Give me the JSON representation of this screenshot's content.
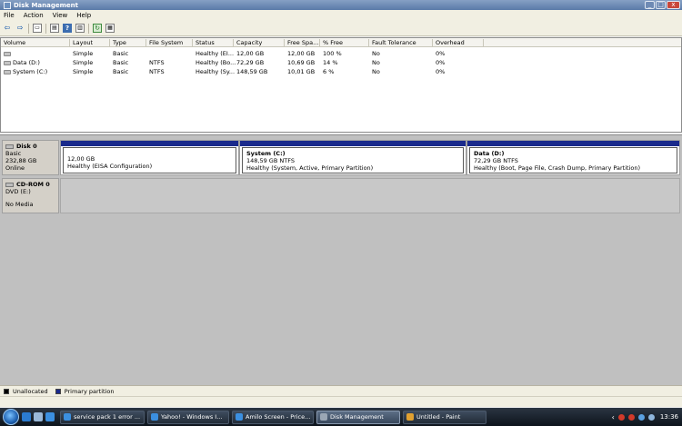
{
  "window": {
    "title": "Disk Management"
  },
  "window_controls": {
    "minimize": "_",
    "maximize": "□",
    "close": "x"
  },
  "menu": [
    "File",
    "Action",
    "View",
    "Help"
  ],
  "toolbar": {
    "back_glyph": "⇦",
    "forward_glyph": "⇨",
    "icons": [
      "back-arrow-icon",
      "forward-arrow-icon",
      "disk-list-icon",
      "properties-icon",
      "help-icon",
      "refresh-icon",
      "rescan-icon"
    ]
  },
  "volume_list": {
    "columns": [
      "Volume",
      "Layout",
      "Type",
      "File System",
      "Status",
      "Capacity",
      "Free Spa...",
      "% Free",
      "Fault Tolerance",
      "Overhead"
    ],
    "rows": [
      [
        "",
        "Simple",
        "Basic",
        "",
        "Healthy (EI...",
        "12,00 GB",
        "12,00 GB",
        "100 %",
        "No",
        "0%"
      ],
      [
        "Data (D:)",
        "Simple",
        "Basic",
        "NTFS",
        "Healthy (Bo...",
        "72,29 GB",
        "10,69 GB",
        "14 %",
        "No",
        "0%"
      ],
      [
        "System (C:)",
        "Simple",
        "Basic",
        "NTFS",
        "Healthy (Sy...",
        "148,59 GB",
        "10,01 GB",
        "6 %",
        "No",
        "0%"
      ]
    ]
  },
  "disks": [
    {
      "name": "Disk 0",
      "type": "Basic",
      "size": "232,88 GB",
      "status": "Online",
      "partitions": [
        {
          "name": "",
          "size": "12,00 GB",
          "status": "Healthy (EISA Configuration)"
        },
        {
          "name": "System  (C:)",
          "size": "148,59 GB NTFS",
          "status": "Healthy (System, Active, Primary Partition)"
        },
        {
          "name": "Data  (D:)",
          "size": "72,29 GB NTFS",
          "status": "Healthy (Boot, Page File, Crash Dump, Primary Partition)"
        }
      ]
    },
    {
      "name": "CD-ROM 0",
      "type": "DVD (E:)",
      "status": "No Media"
    }
  ],
  "legend": [
    {
      "label": "Unallocated",
      "color": "#000000"
    },
    {
      "label": "Primary partition",
      "color": "#1a2a8c"
    }
  ],
  "taskbar": {
    "buttons": [
      {
        "label": "service pack 1 error ...",
        "icon_color": "#3b8fe0"
      },
      {
        "label": "Yahoo! - Windows I...",
        "icon_color": "#3b8fe0"
      },
      {
        "label": "Amilo Screen - Price...",
        "icon_color": "#3b8fe0"
      },
      {
        "label": "Disk Management",
        "icon_color": "#9aa6b4"
      },
      {
        "label": "Untitled - Paint",
        "icon_color": "#e0a030"
      }
    ],
    "clock": "13:36"
  }
}
